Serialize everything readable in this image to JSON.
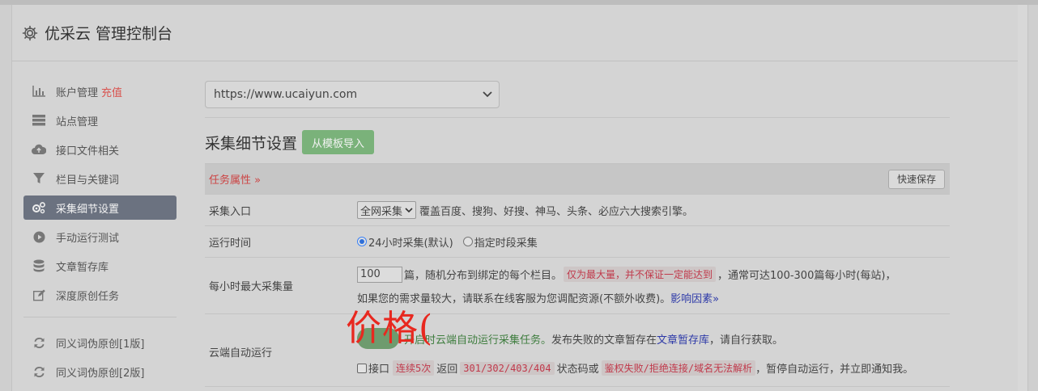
{
  "header": {
    "title": "优采云 管理控制台",
    "icon": "gear-icon"
  },
  "sidebar": {
    "items": [
      {
        "label": "账户管理",
        "badge": "充值",
        "icon": "bar-chart-icon"
      },
      {
        "label": "站点管理",
        "icon": "server-icon"
      },
      {
        "label": "接口文件相关",
        "icon": "cloud-upload-icon"
      },
      {
        "label": "栏目与关键词",
        "icon": "filter-icon"
      },
      {
        "label": "采集细节设置",
        "icon": "cogs-icon"
      },
      {
        "label": "手动运行测试",
        "icon": "play-circle-icon"
      },
      {
        "label": "文章暂存库",
        "icon": "database-icon"
      },
      {
        "label": "深度原创任务",
        "icon": "edit-icon"
      },
      {
        "label": "同义词伪原创[1版]",
        "icon": "refresh-icon"
      },
      {
        "label": "同义词伪原创[2版]",
        "icon": "refresh-icon"
      }
    ]
  },
  "main": {
    "site_select": "https://www.ucaiyun.com",
    "section_title": "采集细节设置",
    "import_button": "从模板导入",
    "task_attr": "任务属性 »",
    "quick_save": "快速保存",
    "rows": {
      "entry": {
        "label": "采集入口",
        "select": "全网采集",
        "desc": "覆盖百度、搜狗、好搜、神马、头条、必应六大搜索引擎。"
      },
      "runtime": {
        "label": "运行时间",
        "opt1": "24小时采集(默认)",
        "opt2": "指定时段采集"
      },
      "max": {
        "label": "每小时最大采集量",
        "value": "100",
        "text1": "篇，随机分布到绑定的每个栏目。",
        "warn": "仅为最大量，并不保证一定能达到",
        "text2": "，通常可达100-300篇每小时(每站)，",
        "text3": "如果您的需求量较大，请联系在线客服为您调配资源(不额外收费)。",
        "link": "影响因素»"
      },
      "cloud": {
        "label": "云端自动运行",
        "green": "开启时云端自动运行采集任务。",
        "text1": "发布失败的文章暂存在",
        "link": "文章暂存库",
        "text2": "，请自行获取。",
        "cb_label": "接口",
        "c1": "连续5次",
        "t1": "返回",
        "c2": "301/302/403/404",
        "t2": "状态码或",
        "c3": "鉴权失败/拒绝连接/域名无法解析",
        "t3": "，暂停自动运行，并立即通知我。"
      }
    }
  },
  "overlay": {
    "text": "价格("
  }
}
